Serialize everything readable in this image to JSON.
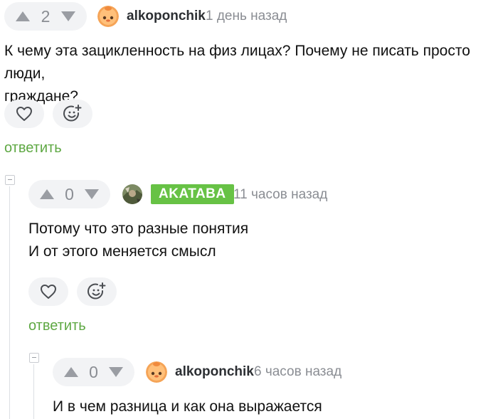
{
  "comments": [
    {
      "rating": "2",
      "username": "alkoponchik",
      "time": "1 день назад",
      "lines": [
        "К чему эта зацикленность на физ лицах? Почему не писать просто люди,",
        "граждане?"
      ],
      "reply_label": "ответить"
    },
    {
      "rating": "0",
      "username": "AKATABA",
      "time": "11 часов назад",
      "lines": [
        "Потому что это разные понятия",
        "И от этого меняется смысл"
      ],
      "reply_label": "ответить",
      "badge_color": "#67c245"
    },
    {
      "rating": "0",
      "username": "alkoponchik",
      "time": "6 часов назад",
      "lines": [
        "И в чем разница и как она выражается"
      ]
    }
  ],
  "colors": {
    "accent_green": "#5ea843",
    "badge_green": "#67c245",
    "arrow_gray": "#9a9da3",
    "pill_bg": "#f2f3f5"
  },
  "icons": [
    "arrow-up-icon",
    "arrow-down-icon",
    "heart-icon",
    "add-emoji-icon",
    "collapse-icon"
  ]
}
